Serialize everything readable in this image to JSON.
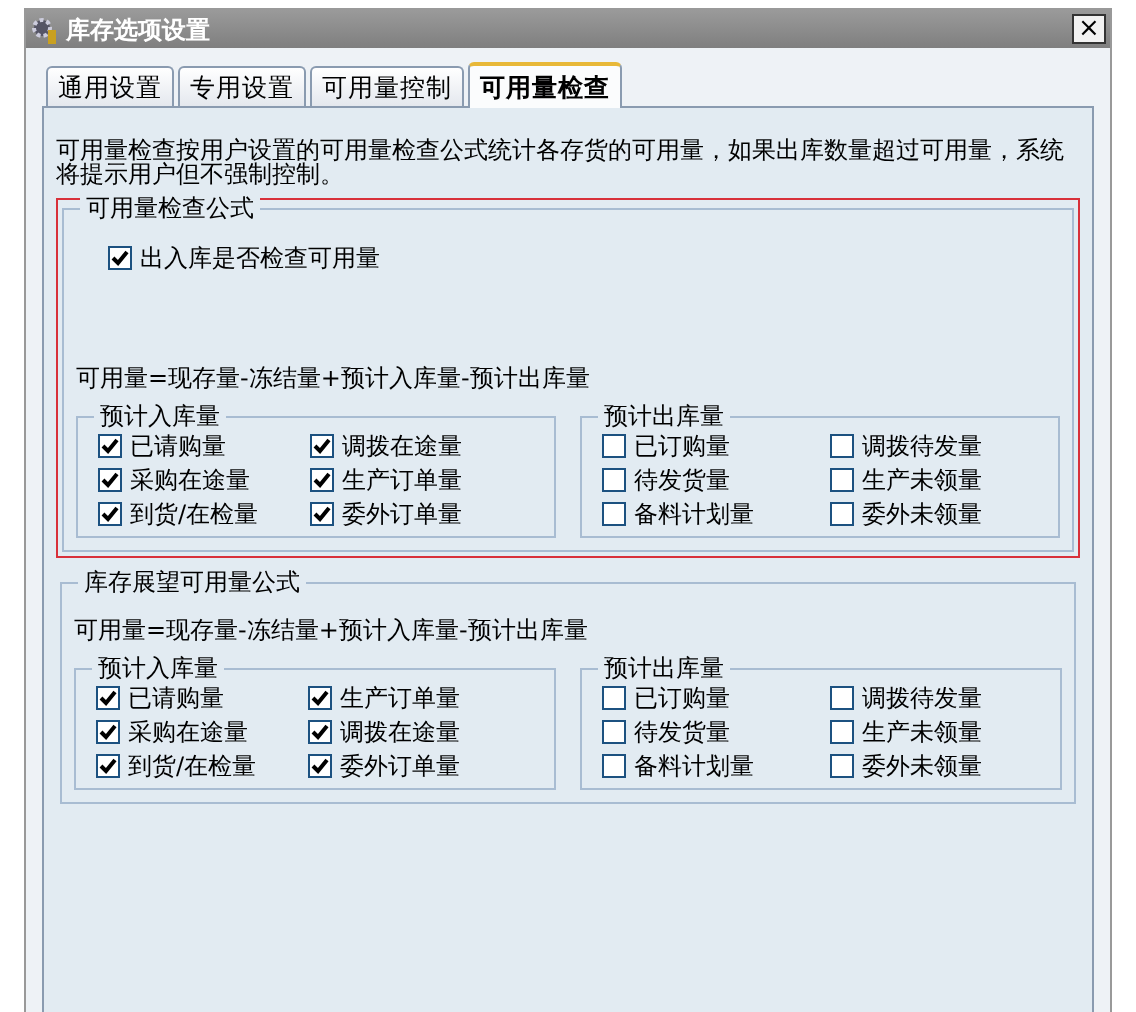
{
  "window": {
    "title": "库存选项设置",
    "close": "×"
  },
  "tabs": [
    {
      "label": "通用设置",
      "selected": false
    },
    {
      "label": "专用设置",
      "selected": false
    },
    {
      "label": "可用量控制",
      "selected": false
    },
    {
      "label": "可用量检查",
      "selected": true
    }
  ],
  "description": "可用量检查按用户设置的可用量检查公式统计各存货的可用量，如果出库数量超过可用量，系统将提示用户但不强制控制。",
  "sections": [
    {
      "title": "可用量检查公式",
      "highlighted": true,
      "check": {
        "label": "出入库是否检查可用量",
        "checked": true
      },
      "formula": "可用量=现存量-冻结量+预计入库量-预计出库量",
      "groups": [
        {
          "title": "预计入库量",
          "items": [
            {
              "label": "已请购量",
              "checked": true
            },
            {
              "label": "调拨在途量",
              "checked": true
            },
            {
              "label": "采购在途量",
              "checked": true
            },
            {
              "label": "生产订单量",
              "checked": true
            },
            {
              "label": "到货/在检量",
              "checked": true
            },
            {
              "label": "委外订单量",
              "checked": true
            }
          ]
        },
        {
          "title": "预计出库量",
          "items": [
            {
              "label": "已订购量",
              "checked": false
            },
            {
              "label": "调拨待发量",
              "checked": false
            },
            {
              "label": "待发货量",
              "checked": false
            },
            {
              "label": "生产未领量",
              "checked": false
            },
            {
              "label": "备料计划量",
              "checked": false
            },
            {
              "label": "委外未领量",
              "checked": false
            }
          ]
        }
      ]
    },
    {
      "title": "库存展望可用量公式",
      "highlighted": false,
      "formula": "可用量=现存量-冻结量+预计入库量-预计出库量",
      "groups": [
        {
          "title": "预计入库量",
          "items": [
            {
              "label": "已请购量",
              "checked": true
            },
            {
              "label": "生产订单量",
              "checked": true
            },
            {
              "label": "采购在途量",
              "checked": true
            },
            {
              "label": "调拨在途量",
              "checked": true
            },
            {
              "label": "到货/在检量",
              "checked": true
            },
            {
              "label": "委外订单量",
              "checked": true
            }
          ]
        },
        {
          "title": "预计出库量",
          "items": [
            {
              "label": "已订购量",
              "checked": false
            },
            {
              "label": "调拨待发量",
              "checked": false
            },
            {
              "label": "待发货量",
              "checked": false
            },
            {
              "label": "生产未领量",
              "checked": false
            },
            {
              "label": "备料计划量",
              "checked": false
            },
            {
              "label": "委外未领量",
              "checked": false
            }
          ]
        }
      ]
    }
  ]
}
